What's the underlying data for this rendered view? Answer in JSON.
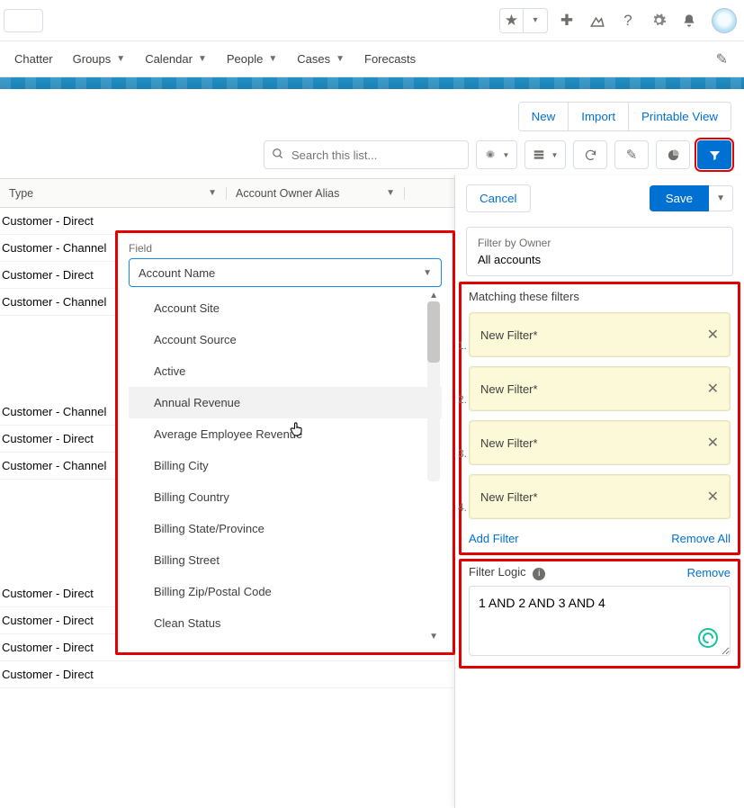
{
  "nav": {
    "tabs": [
      "Chatter",
      "Groups",
      "Calendar",
      "People",
      "Cases",
      "Forecasts"
    ],
    "dropdowns": [
      false,
      true,
      true,
      true,
      true,
      false
    ]
  },
  "actions": {
    "new": "New",
    "import": "Import",
    "printable": "Printable View",
    "search_placeholder": "Search this list..."
  },
  "columns": {
    "type": "Type",
    "owner": "Account Owner Alias"
  },
  "rows": [
    "Customer - Direct",
    "Customer - Channel",
    "Customer - Direct",
    "Customer - Channel",
    "",
    "Customer - Channel",
    "Customer - Direct",
    "Customer - Channel",
    "",
    "Customer - Direct",
    "Customer - Direct",
    "Customer - Direct",
    "Customer - Direct"
  ],
  "fieldDropdown": {
    "label": "Field",
    "selected": "Account Name",
    "options": [
      "Account Site",
      "Account Source",
      "Active",
      "Annual Revenue",
      "Average Employee Revenue",
      "Billing City",
      "Billing Country",
      "Billing State/Province",
      "Billing Street",
      "Billing Zip/Postal Code",
      "Clean Status"
    ],
    "hoverIndex": 3
  },
  "filterPanel": {
    "cancel": "Cancel",
    "save": "Save",
    "ownerLabel": "Filter by Owner",
    "ownerValue": "All accounts",
    "matchingLabel": "Matching these filters",
    "filters": [
      "New Filter*",
      "New Filter*",
      "New Filter*",
      "New Filter*"
    ],
    "addFilter": "Add Filter",
    "removeAll": "Remove All",
    "logicLabel": "Filter Logic",
    "logicRemove": "Remove",
    "logicValue": "1 AND 2 AND 3 AND 4"
  }
}
